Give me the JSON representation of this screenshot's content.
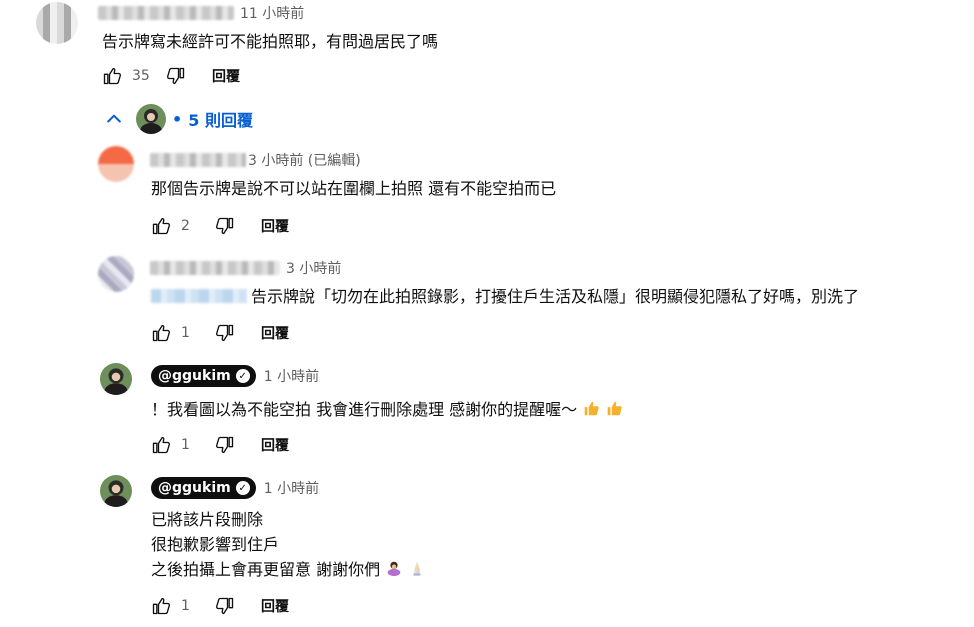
{
  "comment_main": {
    "time": "11 小時前",
    "text": "告示牌寫未經許可不能拍照耶，有問過居民了嗎",
    "likes": "35",
    "reply_label": "回覆"
  },
  "replies_toggle": {
    "label": "5 則回覆",
    "bullet": "•"
  },
  "replies": [
    {
      "time": "3 小時前 (已編輯)",
      "lines": [
        "那個告示牌是說不可以站在圍欄上拍照 還有不能空拍而已"
      ],
      "likes": "2",
      "reply_label": "回覆"
    },
    {
      "time": "3 小時前",
      "lines": [
        "告示牌說「切勿在此拍照錄影，打擾住戶生活及私隱」很明顯侵犯隱私了好嗎，別洗了"
      ],
      "likes": "1",
      "reply_label": "回覆"
    },
    {
      "handle": "@ggukim",
      "time": "1 小時前",
      "lines": [
        "！我看圖以為不能空拍 我會進行刪除處理 感謝你的提醒喔〜"
      ],
      "likes": "1",
      "reply_label": "回覆"
    },
    {
      "handle": "@ggukim",
      "time": "1 小時前",
      "lines": [
        "已將該片段刪除",
        "很抱歉影響到住戶",
        "之後拍攝上會再更留意 謝謝你們"
      ],
      "likes": "1",
      "reply_label": "回覆"
    }
  ],
  "icons": {
    "like": "thumbs-up-outline-icon",
    "dislike": "thumbs-down-outline-icon",
    "chevron": "chevron-up-icon",
    "verified": "verified-check-icon"
  },
  "colors": {
    "link_blue": "#065fd4",
    "meta_gray": "#606060",
    "text": "#0f0f0f"
  }
}
